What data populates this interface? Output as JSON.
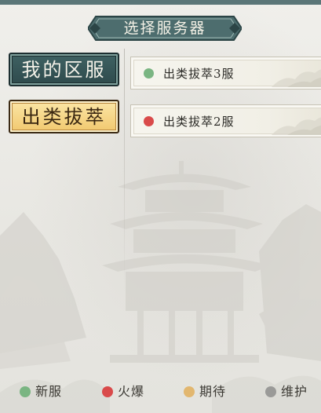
{
  "header": {
    "title": "选择服务器"
  },
  "tabs": [
    {
      "label": "我的区服",
      "state": "normal"
    },
    {
      "label": "出类拔萃",
      "state": "selected"
    }
  ],
  "servers": [
    {
      "name": "出类拔萃3服",
      "status": "new",
      "status_color": "#7ab582"
    },
    {
      "name": "出类拔萃2服",
      "status": "hot",
      "status_color": "#d94a4a"
    }
  ],
  "legend": [
    {
      "label": "新服",
      "color": "#7ab582"
    },
    {
      "label": "火爆",
      "color": "#d94a4a"
    },
    {
      "label": "期待",
      "color": "#e2b76f"
    },
    {
      "label": "维护",
      "color": "#9a9a98"
    }
  ],
  "colors": {
    "accent_teal": "#3f6263",
    "accent_gold": "#f1c86e",
    "background": "#ecebe6"
  }
}
